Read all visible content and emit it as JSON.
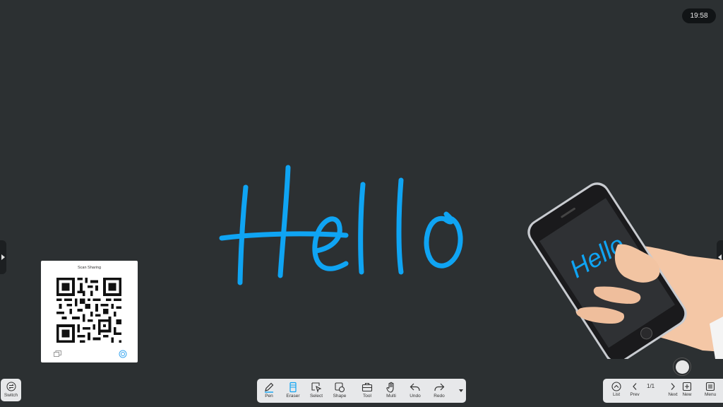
{
  "status": {
    "clock": "19:58"
  },
  "canvas": {
    "handwriting": "Hello",
    "ink_color": "#0fa4f3"
  },
  "phone": {
    "screen_text": "Hello"
  },
  "qr_panel": {
    "title": "Scan Sharing"
  },
  "left_controls": {
    "switch_label": "Switch"
  },
  "toolbar": {
    "tools": [
      {
        "label": "Pen",
        "icon": "pen-icon"
      },
      {
        "label": "Eraser",
        "icon": "eraser-icon"
      },
      {
        "label": "Select",
        "icon": "select-icon"
      },
      {
        "label": "Shape",
        "icon": "shape-icon"
      },
      {
        "label": "Tool",
        "icon": "toolbox-icon"
      },
      {
        "label": "Multi",
        "icon": "hand-icon"
      },
      {
        "label": "Undo",
        "icon": "undo-icon"
      },
      {
        "label": "Redo",
        "icon": "redo-icon"
      }
    ]
  },
  "pager": {
    "list_label": "List",
    "prev_label": "Prev",
    "page_indicator": "1/1",
    "next_label": "Next",
    "new_label": "New",
    "menu_label": "Menu"
  },
  "colors": {
    "background": "#2c3032",
    "accent": "#0fa4f3",
    "bar": "#e7e8ea"
  }
}
